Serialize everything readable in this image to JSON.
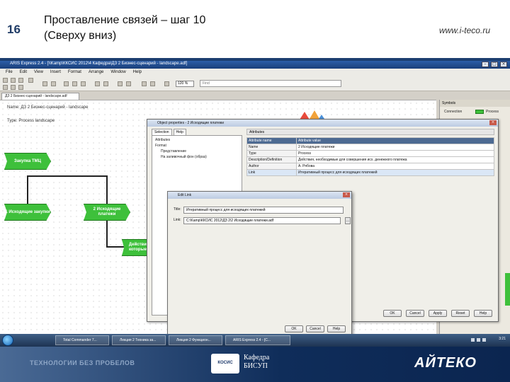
{
  "slide": {
    "number": "16",
    "title_line1": "Проставление связей – шаг 10",
    "title_line2": "(Сверху вниз)",
    "url": "www.i-teco.ru"
  },
  "app": {
    "window_title": "ARIS Express 2.4 - [\\\\Kamp\\ККСИС 2012\\4 Кафедра\\ДЗ 2 Бизнес-сценарий - landscape.adf]",
    "menu": [
      "File",
      "Edit",
      "View",
      "Insert",
      "Format",
      "Arrange",
      "Window",
      "Help"
    ],
    "zoom": "120 %",
    "search_placeholder": "Find",
    "doc_tab": "ДЗ 2 Бизнес-сценарий - landscape.adf",
    "canvas_name": "Name: ДЗ 2 Бизнес-сценарий - landscape",
    "canvas_type": "Type: Process landscape",
    "nodes": {
      "n1": "Закупка ТМЦ",
      "n2": "1 Исходящие закупки",
      "n3": "2 Исходящие платежи",
      "n4": "Действия, которые..."
    },
    "palette": {
      "header": "Symbols",
      "items": [
        "Connection",
        "Process"
      ]
    }
  },
  "props_dialog": {
    "title": "Object properties - 2 Исходящие платежи",
    "tabs": [
      "Selection",
      "Help"
    ],
    "tree": [
      "Attributes",
      "Format",
      "Представление",
      "На заливочный фон (образ)"
    ],
    "section_header": "Attributes",
    "table_head": [
      "Attribute name",
      "Attribute value"
    ],
    "rows": [
      {
        "k": "Name",
        "v": "2 Исходящие платежи"
      },
      {
        "k": "Type",
        "v": "Process"
      },
      {
        "k": "Description/Definition",
        "v": "Действия, необходимые для совершения исх. денежного платежа"
      },
      {
        "k": "Author",
        "v": "А. Рябова"
      },
      {
        "k": "Link",
        "v": "Итеративный процесс для исходящих платежей"
      }
    ],
    "buttons": [
      "OK",
      "Cancel",
      "Apply",
      "Reset",
      "Help"
    ]
  },
  "link_dialog": {
    "title": "Edit Link",
    "title_label": "Title:",
    "title_value": "Итеративный процесс для исходящих платежей",
    "link_label": "Link:",
    "link_value": "C:\\Kamp\\ККСИС 2012\\ДЗ 2\\2 Исходящие платежи.adf",
    "browse": "...",
    "buttons": [
      "OK",
      "Cancel",
      "Help"
    ]
  },
  "taskbar": {
    "items": [
      "Total Commander 7...",
      "Лекция 2 Техника за...",
      "Лекция 2 Функцион...",
      "ARIS Express 2.4 - [C..."
    ],
    "clock": "3:21"
  },
  "footer": {
    "slogan": "ТЕХНОЛОГИИ БЕЗ ПРОБЕЛОВ",
    "dept_logo_text": "КОСИС",
    "dept_line1": "Кафедра",
    "dept_line2": "БИСУП",
    "brand": "АЙТЕКО"
  },
  "colors": {
    "accent": "#1c3e70",
    "process_green": "#3ec03b",
    "footer_dark": "#0f2d5a"
  }
}
